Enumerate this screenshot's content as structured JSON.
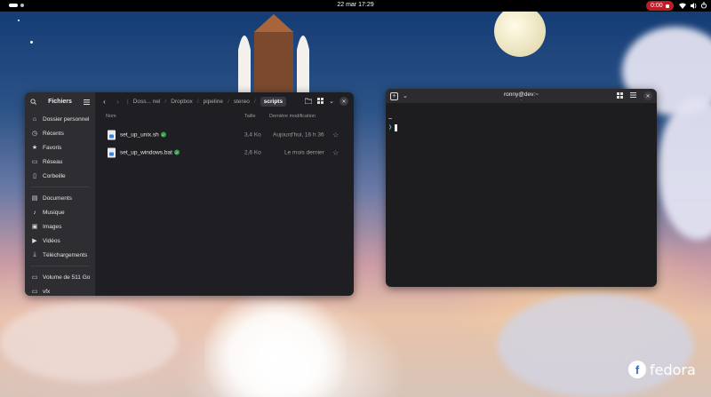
{
  "topbar": {
    "clock": "22 mar  17:29",
    "recording_time": "0:00"
  },
  "files": {
    "sidebar_title": "Fichiers",
    "places": [
      {
        "label": "Dossier personnel",
        "icon": "home-icon"
      },
      {
        "label": "Récents",
        "icon": "clock-icon"
      },
      {
        "label": "Favoris",
        "icon": "star-icon"
      },
      {
        "label": "Réseau",
        "icon": "network-icon"
      },
      {
        "label": "Corbeille",
        "icon": "trash-icon"
      }
    ],
    "folders": [
      {
        "label": "Documents",
        "icon": "document-icon"
      },
      {
        "label": "Musique",
        "icon": "music-icon"
      },
      {
        "label": "Images",
        "icon": "image-icon"
      },
      {
        "label": "Vidéos",
        "icon": "video-icon"
      },
      {
        "label": "Téléchargements",
        "icon": "download-icon"
      }
    ],
    "devices": [
      {
        "label": "Volume de 511 Go",
        "icon": "drive-icon"
      },
      {
        "label": "vfx",
        "icon": "drive-icon"
      }
    ],
    "breadcrumbs": [
      "Doss... nel",
      "Dropbox",
      "pipeline",
      "stereo"
    ],
    "current_folder": "scripts",
    "columns": {
      "name": "Nom",
      "size": "Taille",
      "modified": "Dernière modification"
    },
    "rows": [
      {
        "name": "set_up_unix.sh",
        "size": "3,4 Ko",
        "modified": "Aujourd'hui, 16 h 36"
      },
      {
        "name": "set_up_windows.bat",
        "size": "2,6 Ko",
        "modified": "Le mois dernier"
      }
    ]
  },
  "terminal": {
    "title": "ronny@dev:~",
    "subtitle": "~",
    "line1": "~",
    "prompt": "❯"
  },
  "branding": {
    "logo_text": "fedora",
    "logo_glyph": "f"
  },
  "colors": {
    "accent": "#3584e4",
    "record": "#c01c28",
    "prompt": "#3bc2f0",
    "ok": "#33a34c"
  }
}
